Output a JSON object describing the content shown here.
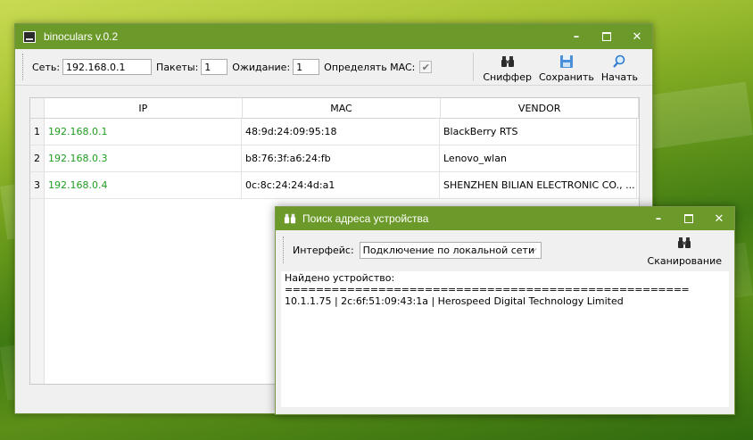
{
  "main": {
    "title": "binoculars v.0.2",
    "controls": {
      "minimize": "–",
      "close": "✕"
    },
    "toolbar": {
      "net_label": "Сеть:",
      "net_value": "192.168.0.1",
      "packets_label": "Пакеты:",
      "packets_value": "1",
      "wait_label": "Ожидание:",
      "wait_value": "1",
      "detect_mac_label": "Определять MAC:",
      "detect_mac_checked": true,
      "sniffer_label": "Сниффер",
      "save_label": "Сохранить",
      "start_label": "Начать"
    },
    "table": {
      "columns": [
        "IP",
        "MAC",
        "VENDOR"
      ],
      "rows": [
        {
          "num": "1",
          "ip": "192.168.0.1",
          "mac": "48:9d:24:09:95:18",
          "vendor": "BlackBerry RTS"
        },
        {
          "num": "2",
          "ip": "192.168.0.3",
          "mac": "b8:76:3f:a6:24:fb",
          "vendor": "Lenovo_wlan"
        },
        {
          "num": "3",
          "ip": "192.168.0.4",
          "mac": "0c:8c:24:24:4d:a1",
          "vendor": "SHENZHEN BILIAN ELECTRONIC CO., ..."
        }
      ]
    }
  },
  "dialog": {
    "title": "Поиск адреса устройства",
    "interface_label": "Интерфейс:",
    "interface_value": "Подключение по локальной сети",
    "scan_label": "Сканирование",
    "output": {
      "line1": "Найдено устройство:",
      "line2": "====================================================",
      "line3": "10.1.1.75 | 2c:6f:51:09:43:1a | Herospeed Digital Technology Limited"
    }
  },
  "colors": {
    "titlebar": "#6b9a2a",
    "ip_text": "#1f9e1f",
    "window_bg": "#f0f0f0"
  }
}
